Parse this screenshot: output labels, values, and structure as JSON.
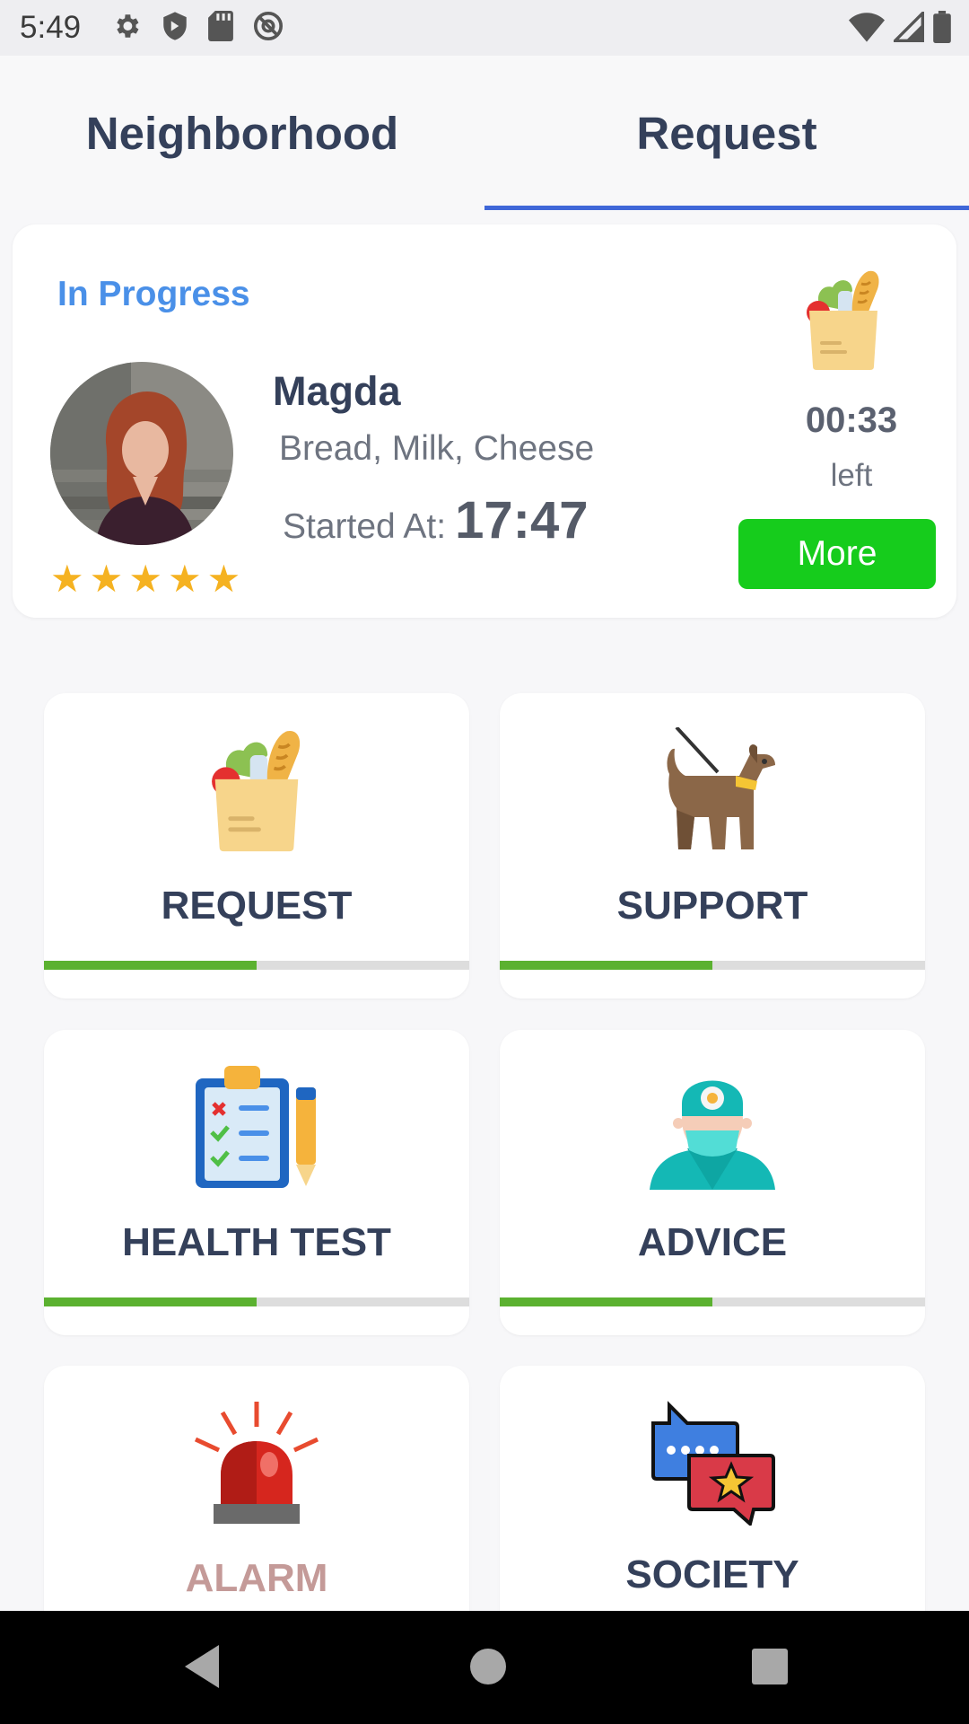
{
  "status_bar": {
    "time": "5:49",
    "left_icons": [
      "gear-icon",
      "shield-icon",
      "sd-card-icon",
      "at-sign-icon"
    ],
    "right_icons": [
      "wifi-icon",
      "signal-icon",
      "battery-icon"
    ]
  },
  "tabs": [
    {
      "label": "Neighborhood",
      "active": false
    },
    {
      "label": "Request",
      "active": true
    }
  ],
  "active_request": {
    "status": "In Progress",
    "name": "Magda",
    "items": "Bread, Milk, Cheese",
    "started_label": "Started At:",
    "started_time": "17:47",
    "rating": 5,
    "time_left": "00:33",
    "left_label": "left",
    "more_label": "More",
    "accent_color": "#4a90e8",
    "button_color": "#16cc1c"
  },
  "categories": [
    {
      "label": "REQUEST",
      "icon": "grocery-bag-icon",
      "progress": 0.5
    },
    {
      "label": "SUPPORT",
      "icon": "guide-dog-icon",
      "progress": 0.5
    },
    {
      "label": "HEALTH TEST",
      "icon": "clipboard-checklist-icon",
      "progress": 0.5
    },
    {
      "label": "ADVICE",
      "icon": "doctor-icon",
      "progress": 0.5
    },
    {
      "label": "ALARM",
      "icon": "siren-icon",
      "progress": null
    },
    {
      "label": "SOCIETY",
      "icon": "chat-bubbles-icon",
      "progress": null
    }
  ],
  "nav_bar": {
    "buttons": [
      "back-icon",
      "home-icon",
      "recents-icon"
    ]
  }
}
